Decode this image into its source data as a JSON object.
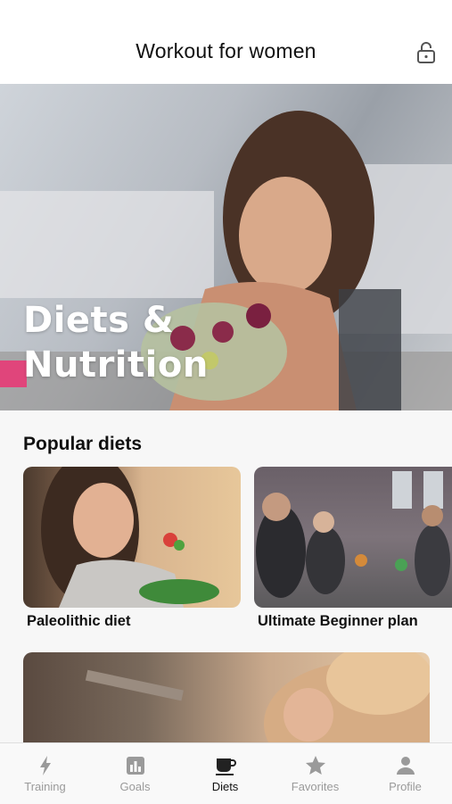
{
  "header": {
    "title": "Workout for women",
    "lock_icon": "lock-icon"
  },
  "hero": {
    "title_line1": "Diets &",
    "title_line2": "Nutrition"
  },
  "section": {
    "title": "Popular diets"
  },
  "cards": [
    {
      "label": "Paleolithic diet"
    },
    {
      "label": "Ultimate Beginner plan"
    }
  ],
  "tabs": [
    {
      "label": "Training",
      "icon": "bolt-icon",
      "active": false
    },
    {
      "label": "Goals",
      "icon": "chart-icon",
      "active": false
    },
    {
      "label": "Diets",
      "icon": "cup-icon",
      "active": true
    },
    {
      "label": "Favorites",
      "icon": "star-icon",
      "active": false
    },
    {
      "label": "Profile",
      "icon": "person-icon",
      "active": false
    }
  ],
  "colors": {
    "active_tab": "#111111",
    "inactive_tab": "#9a9a9a",
    "accent": "#e0457b"
  }
}
